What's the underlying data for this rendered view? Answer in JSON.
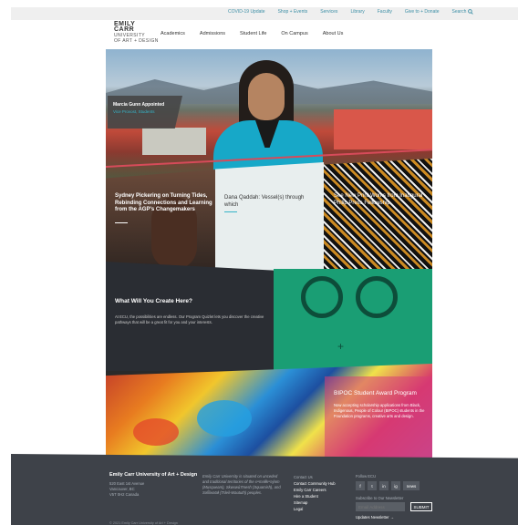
{
  "utility_nav": [
    "COVID-19 Update",
    "Shop + Events",
    "Services",
    "Library",
    "Faculty",
    "Give to + Donate"
  ],
  "search_label": "Search",
  "logo": {
    "line1": "EMILY",
    "line2": "CARR",
    "line3": "UNIVERSITY",
    "line4": "OF ART + DESIGN"
  },
  "main_nav": [
    "Academics",
    "Admissions",
    "Student Life",
    "On Campus",
    "About Us"
  ],
  "hero": {
    "title": "Marcia Gunn Appointed",
    "subtitle": "Vice Provost, Students"
  },
  "cards": [
    {
      "title": "Sydney Pickering on Turning Tides, Rebinding Connections and Learning from the AGP's Changemakers"
    },
    {
      "title": "Dana Qaddah: Vessel(s) through which"
    },
    {
      "title": "See New Print Works from Inaugural Philip Press Fellowship"
    }
  ],
  "create": {
    "title": "What Will You Create Here?",
    "body": "At ECU, the possibilities are endless. Our Program Quizlet lets you discover the creative pathways that will be a great fit for you and your interests."
  },
  "award": {
    "title": "BIPOC Student Award Program",
    "body": "Now accepting scholarship applications from Black, Indigenous, People of Colour (BIPOC) students in the Foundation programs, creative arts and design."
  },
  "footer": {
    "title": "Emily Carr University of Art + Design",
    "addr": [
      "520 East 1st Avenue",
      "Vancouver, BC",
      "V5T 0H2 Canada"
    ],
    "blurb": "Emily Carr University is situated on unceded and traditional territories of the xʷməθkʷəy̓əm (Musqueam), Skwxwú7mesh (Squamish), and Səl̓ílwətaɬ (Tsleil-Waututh) peoples.",
    "links_heading": "Contact Us",
    "links": [
      "Contact Community Hub",
      "Emily Carr Careers",
      "Hire a Student",
      "Sitemap",
      "Legal"
    ],
    "follow": "Follow ECU",
    "social": [
      "f",
      "t",
      "in",
      "ig",
      "news"
    ],
    "subscribe": "Subscribe to Our Newsletter",
    "email_placeholder": "Email Address",
    "submit": "SUBMIT",
    "newsletter": "Updates Newsletter →",
    "copyright": "© 2021 Emily Carr University of Art + Design"
  }
}
